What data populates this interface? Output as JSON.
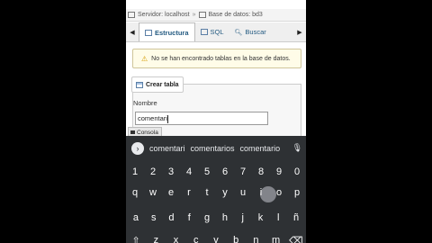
{
  "breadcrumb": {
    "server": "Servidor: localhost",
    "database": "Base de datos: bd3"
  },
  "tabs": [
    {
      "label": "Estructura"
    },
    {
      "label": "SQL"
    },
    {
      "label": "Buscar"
    }
  ],
  "notice": {
    "text": "No se han encontrado tablas en la base de datos."
  },
  "create_table": {
    "legend": "Crear tabla",
    "name_label": "Nombre",
    "name_value": "comentari"
  },
  "console": {
    "label": "Consola"
  },
  "keyboard": {
    "suggestions": [
      "comentari",
      "comentarios",
      "comentario"
    ],
    "numbers": [
      "1",
      "2",
      "3",
      "4",
      "5",
      "6",
      "7",
      "8",
      "9",
      "0"
    ],
    "row1": [
      "q",
      "w",
      "e",
      "r",
      "t",
      "y",
      "u",
      "i",
      "o",
      "p"
    ],
    "row2": [
      "a",
      "s",
      "d",
      "f",
      "g",
      "h",
      "j",
      "k",
      "l",
      "ñ"
    ],
    "row3": [
      "z",
      "x",
      "c",
      "v",
      "b",
      "n",
      "m"
    ]
  }
}
